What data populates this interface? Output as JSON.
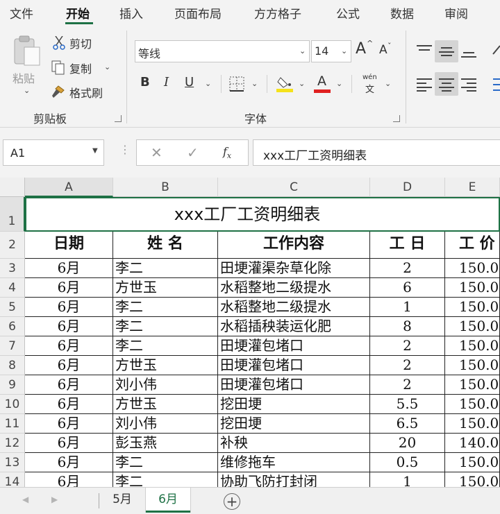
{
  "menu": [
    "文件",
    "开始",
    "插入",
    "页面布局",
    "方方格子",
    "公式",
    "数据",
    "审阅"
  ],
  "ribbon": {
    "paste_label": "粘贴",
    "cut_label": "剪切",
    "copy_label": "复制",
    "format_painter_label": "格式刷",
    "clipboard_group": "剪贴板",
    "font_name": "等线",
    "font_size": "14",
    "grow_font": "A",
    "shrink_font": "A",
    "bold": "B",
    "italic": "I",
    "underline": "U",
    "font_color_letter": "A",
    "wen_top": "wén",
    "wen_bottom": "文",
    "font_group": "字体",
    "fill_color": "#f5e21b",
    "font_color": "#e02020"
  },
  "formula_bar": {
    "name_box": "A1",
    "formula": "xxx工厂工资明细表"
  },
  "columns": [
    "A",
    "B",
    "C",
    "D",
    "E"
  ],
  "rows": [
    "1",
    "2",
    "3",
    "4",
    "5",
    "6",
    "7",
    "8",
    "9",
    "10",
    "11",
    "12",
    "13",
    "14"
  ],
  "sheet": {
    "title": "xxx工厂工资明细表",
    "headers": [
      "日期",
      "姓 名",
      "工作内容",
      "工 日",
      "工 价"
    ],
    "data": [
      [
        "6月",
        "李二",
        "田埂灌渠杂草化除",
        "2",
        "150.0"
      ],
      [
        "6月",
        "方世玉",
        "水稻整地二级提水",
        "6",
        "150.0"
      ],
      [
        "6月",
        "李二",
        "水稻整地二级提水",
        "1",
        "150.0"
      ],
      [
        "6月",
        "李二",
        "水稻插秧装运化肥",
        "8",
        "150.0"
      ],
      [
        "6月",
        "李二",
        "田埂灌包堵口",
        "2",
        "150.0"
      ],
      [
        "6月",
        "方世玉",
        "田埂灌包堵口",
        "2",
        "150.0"
      ],
      [
        "6月",
        "刘小伟",
        "田埂灌包堵口",
        "2",
        "150.0"
      ],
      [
        "6月",
        "方世玉",
        "挖田埂",
        "5.5",
        "150.0"
      ],
      [
        "6月",
        "刘小伟",
        "挖田埂",
        "6.5",
        "150.0"
      ],
      [
        "6月",
        "彭玉燕",
        "补秧",
        "20",
        "140.0"
      ],
      [
        "6月",
        "李二",
        "维修拖车",
        "0.5",
        "150.0"
      ],
      [
        "6月",
        "李二",
        "协助飞防打封闭",
        "1",
        "150.0"
      ]
    ]
  },
  "sheet_tabs": [
    "5月",
    "6月"
  ],
  "add_sheet": "+",
  "accent_color": "#1e7145"
}
